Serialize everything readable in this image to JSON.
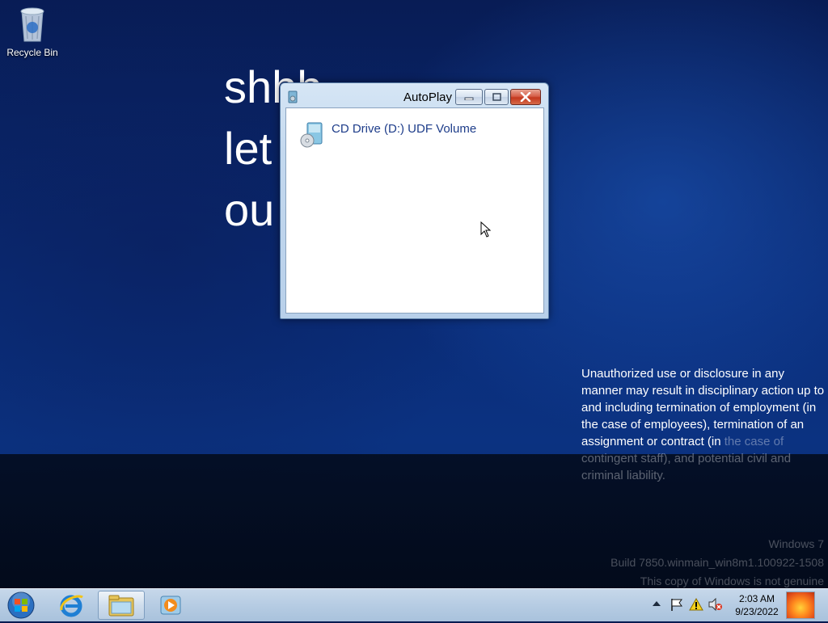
{
  "desktop": {
    "recycle_bin_label": "Recycle Bin",
    "wallpaper_text": [
      "shhh",
      "let",
      "ou"
    ],
    "notice_lines_bright": "Unauthorized use or disclosure in any manner may result in disciplinary action up to and including termination of employment (in the case of employees), termination of an assignment or contract (in",
    "notice_lines_dim": "the case of contingent staff), and potential civil and criminal liability.",
    "watermark": {
      "line1": "Windows 7",
      "line2": "Build 7850.winmain_win8m1.100922-1508",
      "line3": "This copy of Windows is not genuine"
    }
  },
  "autoplay_window": {
    "title": "AutoPlay",
    "item_label": "CD Drive (D:) UDF Volume",
    "item_icon": "cd-drive-icon"
  },
  "taskbar": {
    "start_icon": "windows-orb-icon",
    "pinned": [
      "internet-explorer-icon",
      "windows-explorer-icon",
      "media-player-icon"
    ],
    "clock": {
      "time": "2:03 AM",
      "date": "9/23/2022"
    }
  },
  "colors": {
    "desktop_blue": "#0a2c78",
    "taskbar": "#b6cce3",
    "link_text": "#1e3d8a",
    "close_button": "#c4381f"
  }
}
